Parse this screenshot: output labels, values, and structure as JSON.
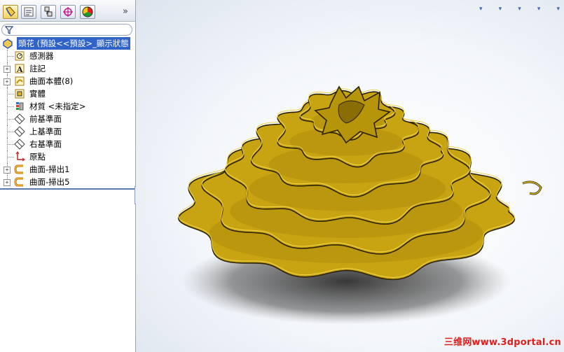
{
  "panel": {
    "tabs": [
      {
        "icon": "feature-manager-icon",
        "active": true
      },
      {
        "icon": "property-manager-icon",
        "active": false
      },
      {
        "icon": "configuration-manager-icon",
        "active": false
      },
      {
        "icon": "dimxpert-manager-icon",
        "active": false
      },
      {
        "icon": "display-manager-icon",
        "active": false
      }
    ],
    "expand_glyph": "»",
    "filter_icon": "filter-icon"
  },
  "tree": {
    "root": "頭花  (預設<<預設>_顯示狀態",
    "items": [
      {
        "label": "感測器",
        "icon": "sensor-icon",
        "expandable": false
      },
      {
        "label": "註記",
        "icon": "annotation-icon",
        "expandable": true
      },
      {
        "label": "曲面本體(8)",
        "icon": "surface-bodies-icon",
        "expandable": true
      },
      {
        "label": "實體",
        "icon": "solid-bodies-icon",
        "expandable": false
      },
      {
        "label": "材質 <未指定>",
        "icon": "material-icon",
        "expandable": false
      },
      {
        "label": "前基準面",
        "icon": "plane-icon",
        "expandable": false
      },
      {
        "label": "上基準面",
        "icon": "plane-icon",
        "expandable": false
      },
      {
        "label": "右基準面",
        "icon": "plane-icon",
        "expandable": false
      },
      {
        "label": "原點",
        "icon": "origin-icon",
        "expandable": false
      },
      {
        "label": "曲面-掃出1",
        "icon": "surface-sweep-icon",
        "expandable": true
      },
      {
        "label": "曲面-掃出5",
        "icon": "surface-sweep-icon",
        "expandable": true
      }
    ]
  },
  "viewport": {
    "model_color": "#c8a312",
    "model_edge_color": "#2a2200",
    "watermark": "三维网www.3dportal.cn"
  }
}
